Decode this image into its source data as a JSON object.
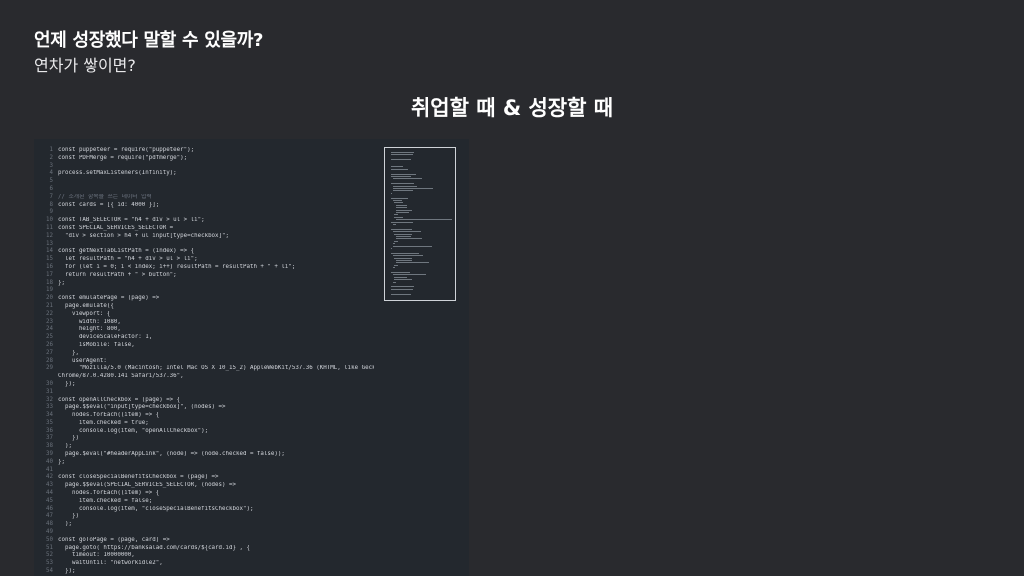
{
  "slide": {
    "title": "언제 성장했다 말할 수 있을까?",
    "subtitle": "연차가 쌓이면?",
    "heading": "취업할 때 & 성장할 때"
  },
  "code_lines": [
    "const puppeteer = require(\"puppeteer\");",
    "const PDFMerge = require(\"pdfmerge\");",
    "",
    "process.setMaxListeners(Infinity);",
    "",
    "",
    "// 소개된 항목을 쓰는 데이터 입력",
    "const cards = [{ id: 4000 }];",
    "",
    "const TAB_SELECTOR = \"h4 + div > ul > li\";",
    "const SPECIAL_SERVICES_SELECTOR =",
    "  \"div > section > h4 + ul input[type=checkbox]\";",
    "",
    "const getNextTabListPath = (index) => {",
    "  let resultPath = \"h4 + div > ul > li\";",
    "  for (let i = 0; i < index; i++) resultPath = resultPath + \" + li\";",
    "  return resultPath + \" > button\";",
    "};",
    "",
    "const emulatePage = (page) =>",
    "  page.emulate({",
    "    viewport: {",
    "      width: 1080,",
    "      height: 800,",
    "      deviceScaleFactor: 1,",
    "      isMobile: false,",
    "    },",
    "    userAgent:",
    "      \"Mozilla/5.0 (Macintosh; Intel Mac OS X 10_15_2) AppleWebKit/537.36 (KHTML, like Gecko)",
    "Chrome/87.0.4280.141 Safari/537.36\",",
    "  });",
    "",
    "const openAllCheckbox = (page) => {",
    "  page.$$eval(\"input[type=checkbox]\", (nodes) =>",
    "    nodes.forEach((item) => {",
    "      item.checked = true;",
    "      console.log(item, \"openAllCheckbox\");",
    "    })",
    "  );",
    "  page.$eval(\"#headerAppLink\", (node) => (node.checked = false));",
    "};",
    "",
    "const closeSpecialBenefitsCheckbox = (page) =>",
    "  page.$$eval(SPECIAL_SERVICES_SELECTOR, (nodes) =>",
    "    nodes.forEach((item) => {",
    "      item.checked = false;",
    "      console.log(item, \"closeSpecialBenefitsCheckbox\");",
    "    })",
    "  );",
    "",
    "const goToPage = (page, card) =>",
    "  page.goto(`https://banksalad.com/cards/${card.id}`, {",
    "    timeout: 10000000,",
    "    waitUntil: \"networkidle2\",",
    "  });",
    ""
  ],
  "line_numbers": [
    "1",
    "2",
    "3",
    "4",
    "5",
    "6",
    "7",
    "8",
    "9",
    "10",
    "11",
    "12",
    "13",
    "14",
    "15",
    "16",
    "17",
    "18",
    "19",
    "20",
    "21",
    "22",
    "23",
    "24",
    "25",
    "26",
    "27",
    "28",
    "29",
    "",
    "30",
    "31",
    "32",
    "33",
    "34",
    "35",
    "36",
    "37",
    "38",
    "39",
    "40",
    "41",
    "42",
    "43",
    "44",
    "45",
    "46",
    "47",
    "48",
    "49",
    "50",
    "51",
    "52",
    "53",
    "54",
    "55"
  ]
}
